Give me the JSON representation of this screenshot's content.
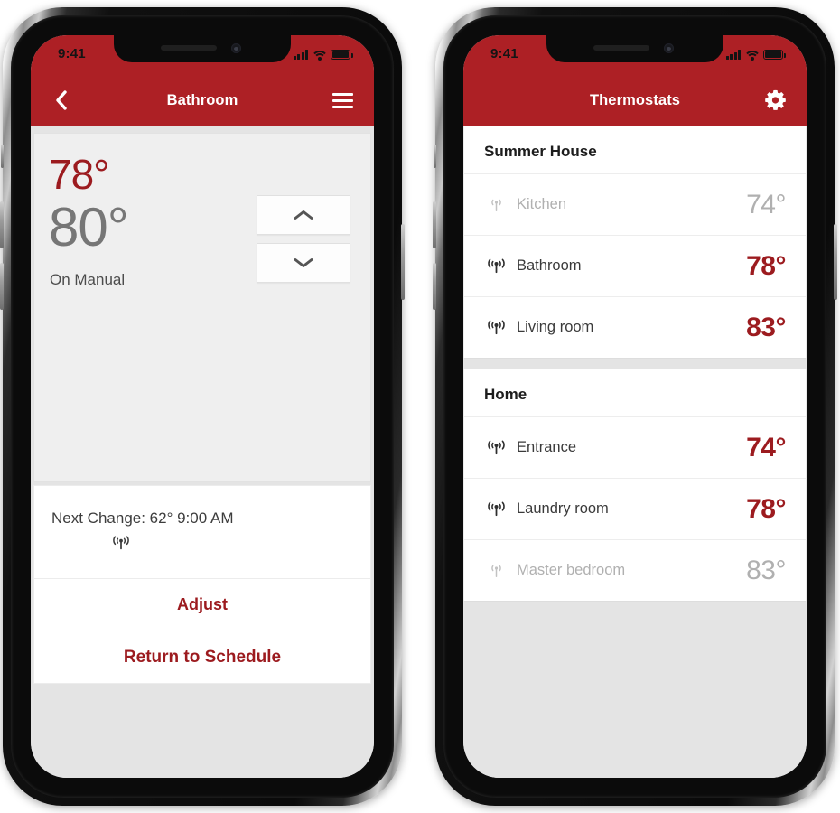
{
  "colors": {
    "brand": "#ad2025",
    "brand_dark": "#9c1b1f",
    "screen_bg": "#e4e4e4",
    "card_bg": "#efefef",
    "row_bg": "#ffffff",
    "muted_text": "#b0b0b0"
  },
  "status_bar": {
    "time": "9:41",
    "signal_icon": "cellular-bars-icon",
    "wifi_icon": "wifi-icon",
    "battery_icon": "battery-full-icon"
  },
  "phone_left": {
    "navbar": {
      "back_icon": "chevron-left-icon",
      "title": "Bathroom",
      "menu_icon": "hamburger-menu-icon"
    },
    "detail": {
      "current_temp": "78°",
      "target_temp": "80°",
      "mode": "On Manual",
      "stepper": {
        "up_icon": "chevron-up-icon",
        "down_icon": "chevron-down-icon",
        "up_label": "Increase temperature",
        "down_label": "Decrease temperature"
      }
    },
    "info": {
      "next_change": "Next Change: 62° 9:00 AM",
      "signal_icon": "antenna-signal-icon"
    },
    "actions": [
      {
        "label": "Adjust",
        "name": "adjust-button"
      },
      {
        "label": "Return to Schedule",
        "name": "return-to-schedule-button"
      }
    ]
  },
  "phone_right": {
    "navbar": {
      "title": "Thermostats",
      "settings_icon": "gear-icon"
    },
    "groups": [
      {
        "title": "Summer House",
        "rows": [
          {
            "icon": "antenna-signal-off-icon",
            "label": "Kitchen",
            "temp": "74°",
            "offline": true
          },
          {
            "icon": "antenna-signal-icon",
            "label": "Bathroom",
            "temp": "78°",
            "offline": false
          },
          {
            "icon": "antenna-signal-icon",
            "label": "Living room",
            "temp": "83°",
            "offline": false
          }
        ]
      },
      {
        "title": "Home",
        "rows": [
          {
            "icon": "antenna-signal-icon",
            "label": "Entrance",
            "temp": "74°",
            "offline": false
          },
          {
            "icon": "antenna-signal-icon",
            "label": "Laundry room",
            "temp": "78°",
            "offline": false
          },
          {
            "icon": "antenna-signal-off-icon",
            "label": "Master bedroom",
            "temp": "83°",
            "offline": true
          }
        ]
      }
    ]
  }
}
